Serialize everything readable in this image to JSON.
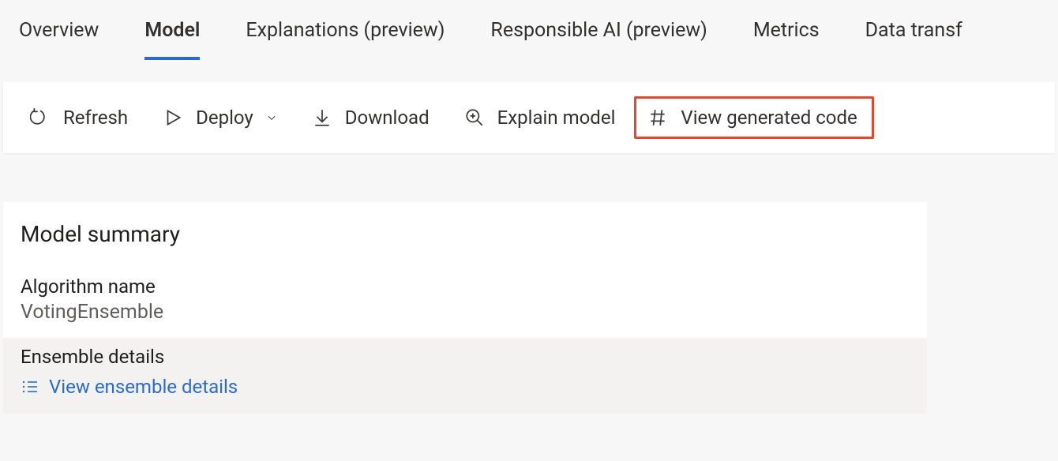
{
  "tabs": {
    "overview": "Overview",
    "model": "Model",
    "explanations": "Explanations (preview)",
    "responsible_ai": "Responsible AI (preview)",
    "metrics": "Metrics",
    "data_transf": "Data transf"
  },
  "toolbar": {
    "refresh": "Refresh",
    "deploy": "Deploy",
    "download": "Download",
    "explain_model": "Explain model",
    "view_generated_code": "View generated code"
  },
  "summary": {
    "title": "Model summary",
    "algorithm_label": "Algorithm name",
    "algorithm_value": "VotingEnsemble",
    "ensemble_label": "Ensemble details",
    "ensemble_link": "View ensemble details"
  }
}
